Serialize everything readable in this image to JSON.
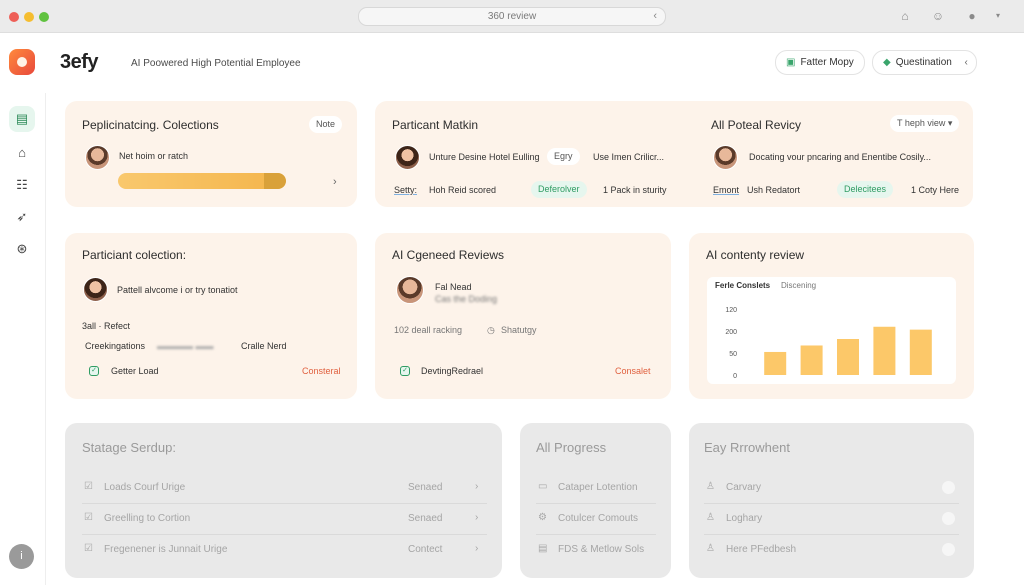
{
  "browser": {
    "url_text": "360 review"
  },
  "header": {
    "brand": "3efy",
    "tagline": "AI Poowered High Potential Employee",
    "btn1": "Fatter Mopy",
    "btn2": "Questination"
  },
  "cards": {
    "c1": {
      "title": "Peplicinatcing. Colections",
      "pill": "Note",
      "line": "Net hoim or ratch"
    },
    "c2": {
      "title": "Particant Matkin",
      "line": "Unture Desine Hotel Eulling",
      "pill": "Egry",
      "line2": "Use Imen Crilicr...",
      "foot_label": "Setty:",
      "foot_value": "Hoh Reid scored",
      "foot_status": "Deferolver",
      "foot_count": "1 Pack in sturity"
    },
    "c3": {
      "title": "All Poteal Revicy",
      "pill": "T heph view",
      "line": "Docating vour pncaring and Enentibe Cosily...",
      "foot_label": "Emont",
      "foot_value": "Ush Redatort",
      "foot_status": "Delecitees",
      "foot_count": "1 Coty Here"
    },
    "c4": {
      "title": "Particiant colection:",
      "line": "Pattell alvcome i or try tonatiot",
      "stat": "3all · Refect",
      "stat2_label": "Creekingations",
      "stat2_value": "Cralle Nerd",
      "action": "Getter Load",
      "status": "Consteral"
    },
    "c5": {
      "title": "AI Cgeneed Reviews",
      "name": "Fal Nead",
      "sub": "Cas the Doding",
      "meta": "102 deall racking",
      "meta2": "Shatutgy",
      "action": "DevtingRedrael",
      "status": "Consalet"
    },
    "c6": {
      "title": "AI contenty review"
    },
    "g1": {
      "title": "Statage Serdup:",
      "rows": [
        {
          "label": "Loads Courf Urige",
          "status": "Senaed"
        },
        {
          "label": "Greelling to Cortion",
          "status": "Senaed"
        },
        {
          "label": "Fregenener is Junnait Urige",
          "status": "Contect"
        }
      ]
    },
    "g2": {
      "title": "All Progress",
      "rows": [
        {
          "label": "Cataper Lotention"
        },
        {
          "label": "Cotulcer Comouts"
        },
        {
          "label": "FDS & Metlow Sols"
        }
      ]
    },
    "g3": {
      "title": "Eay Rrrowhent",
      "rows": [
        {
          "label": "Carvary"
        },
        {
          "label": "Loghary"
        },
        {
          "label": "Here PFedbesh"
        }
      ]
    }
  },
  "chart_data": {
    "type": "bar",
    "title": "Ferle Conslets",
    "subtitle": "Discening",
    "yticks": [
      "120",
      "200",
      "50",
      "0"
    ],
    "values": [
      32,
      41,
      50,
      67,
      63
    ],
    "ylim": [
      0,
      100
    ],
    "color": "#fcc869"
  },
  "colors": {
    "accent_green": "#2f9c63",
    "accent_orange": "#f4b54c",
    "card_bg": "#fdf3ea",
    "status_red": "#e0603f"
  }
}
